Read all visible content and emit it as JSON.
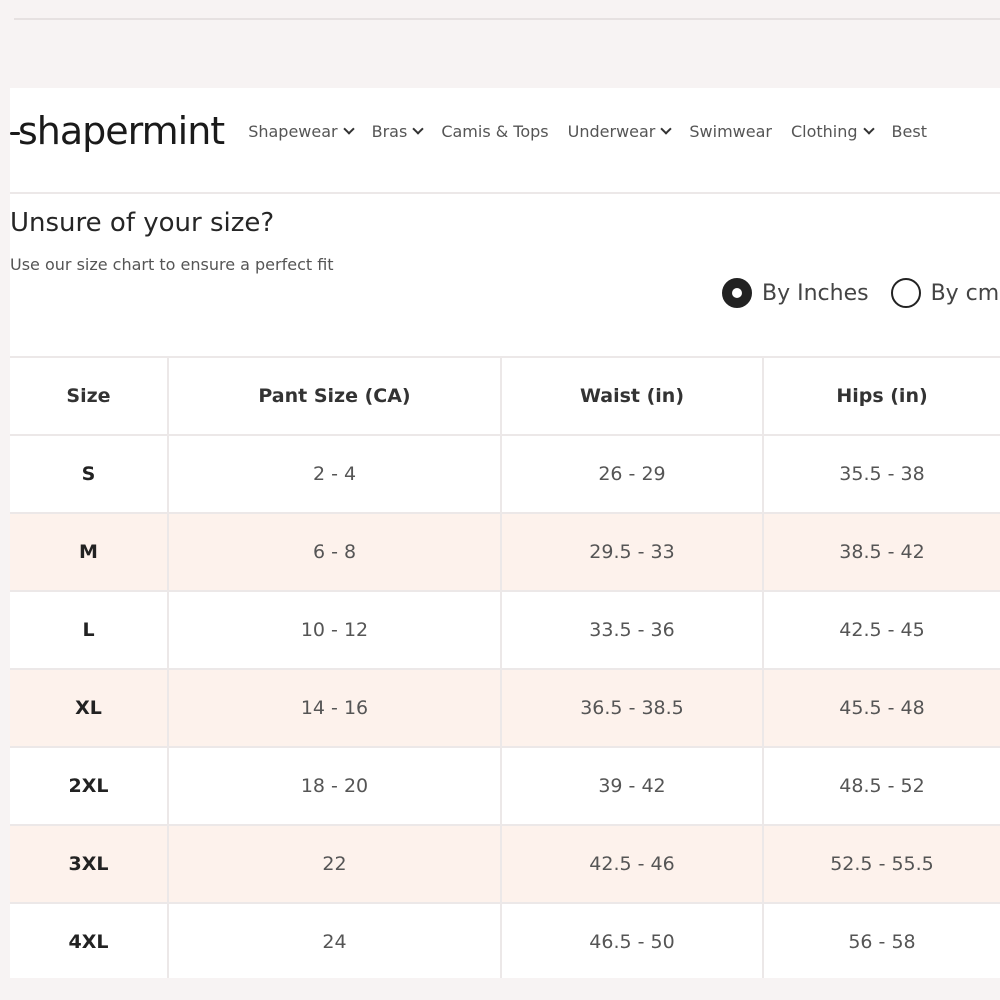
{
  "brand": {
    "logo_text": "shapermint"
  },
  "nav": {
    "items": [
      {
        "label": "Shapewear",
        "has_dropdown": true
      },
      {
        "label": "Bras",
        "has_dropdown": true
      },
      {
        "label": "Camis & Tops",
        "has_dropdown": false
      },
      {
        "label": "Underwear",
        "has_dropdown": true
      },
      {
        "label": "Swimwear",
        "has_dropdown": false
      },
      {
        "label": "Clothing",
        "has_dropdown": true
      },
      {
        "label": "Best",
        "has_dropdown": false
      }
    ]
  },
  "intro": {
    "title": "Unsure of your size?",
    "subtitle": "Use our size chart to ensure a perfect fit"
  },
  "units": {
    "options": [
      {
        "label": "By Inches",
        "selected": true
      },
      {
        "label": "By cm",
        "selected": false
      }
    ]
  },
  "table": {
    "headers": [
      "Size",
      "Pant Size (CA)",
      "Waist (in)",
      "Hips (in)"
    ],
    "rows": [
      [
        "S",
        "2 - 4",
        "26 - 29",
        "35.5 - 38"
      ],
      [
        "M",
        "6 - 8",
        "29.5 - 33",
        "38.5 - 42"
      ],
      [
        "L",
        "10 - 12",
        "33.5 - 36",
        "42.5 - 45"
      ],
      [
        "XL",
        "14 - 16",
        "36.5 - 38.5",
        "45.5 - 48"
      ],
      [
        "2XL",
        "18 - 20",
        "39 - 42",
        "48.5 - 52"
      ],
      [
        "3XL",
        "22",
        "42.5 - 46",
        "52.5 - 55.5"
      ],
      [
        "4XL",
        "24",
        "46.5 - 50",
        "56 - 58"
      ]
    ]
  },
  "colors": {
    "alt_row": "#fdf2ec",
    "text_dark": "#222222",
    "border": "#ece8e8"
  }
}
